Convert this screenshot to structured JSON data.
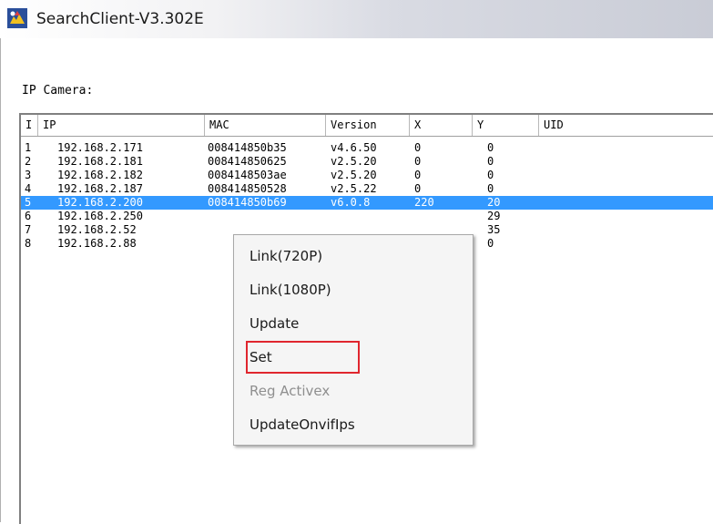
{
  "window": {
    "title": "SearchClient-V3.302E"
  },
  "section_label": "IP Camera:",
  "table": {
    "columns": [
      "I",
      "IP",
      "MAC",
      "Version",
      "X",
      "Y",
      "UID"
    ],
    "rows": [
      {
        "index": "1",
        "ip": "192.168.2.171",
        "mac": "008414850b35",
        "version": "v4.6.50",
        "x": "0",
        "y": "0",
        "uid": ""
      },
      {
        "index": "2",
        "ip": "192.168.2.181",
        "mac": "008414850625",
        "version": "v2.5.20",
        "x": "0",
        "y": "0",
        "uid": ""
      },
      {
        "index": "3",
        "ip": "192.168.2.182",
        "mac": "0084148503ae",
        "version": "v2.5.20",
        "x": "0",
        "y": "0",
        "uid": ""
      },
      {
        "index": "4",
        "ip": "192.168.2.187",
        "mac": "008414850528",
        "version": "v2.5.22",
        "x": "0",
        "y": "0",
        "uid": ""
      },
      {
        "index": "5",
        "ip": "192.168.2.200",
        "mac": "008414850b69",
        "version": "v6.0.8",
        "x": "220",
        "y": "20",
        "uid": ""
      },
      {
        "index": "6",
        "ip": "192.168.2.250",
        "mac": "",
        "version": "",
        "x": "",
        "y": "29",
        "uid": ""
      },
      {
        "index": "7",
        "ip": "192.168.2.52",
        "mac": "",
        "version": "",
        "x": "",
        "y": "35",
        "uid": ""
      },
      {
        "index": "8",
        "ip": "192.168.2.88",
        "mac": "",
        "version": "",
        "x": "",
        "y": "0",
        "uid": ""
      }
    ],
    "selected_row_index": 4
  },
  "context_menu": {
    "items": [
      {
        "label": "Link(720P)",
        "enabled": true
      },
      {
        "label": "Link(1080P)",
        "enabled": true
      },
      {
        "label": "Update",
        "enabled": true
      },
      {
        "label": "Set",
        "enabled": true,
        "highlighted": true
      },
      {
        "label": "Reg Activex",
        "enabled": false
      },
      {
        "label": "UpdateOnvifIps",
        "enabled": true
      }
    ]
  },
  "colors": {
    "selection": "#3399ff",
    "highlight_box": "#e0262e",
    "disabled_text": "#8f8f8f"
  },
  "icons": {
    "app": "app-logo-icon"
  }
}
